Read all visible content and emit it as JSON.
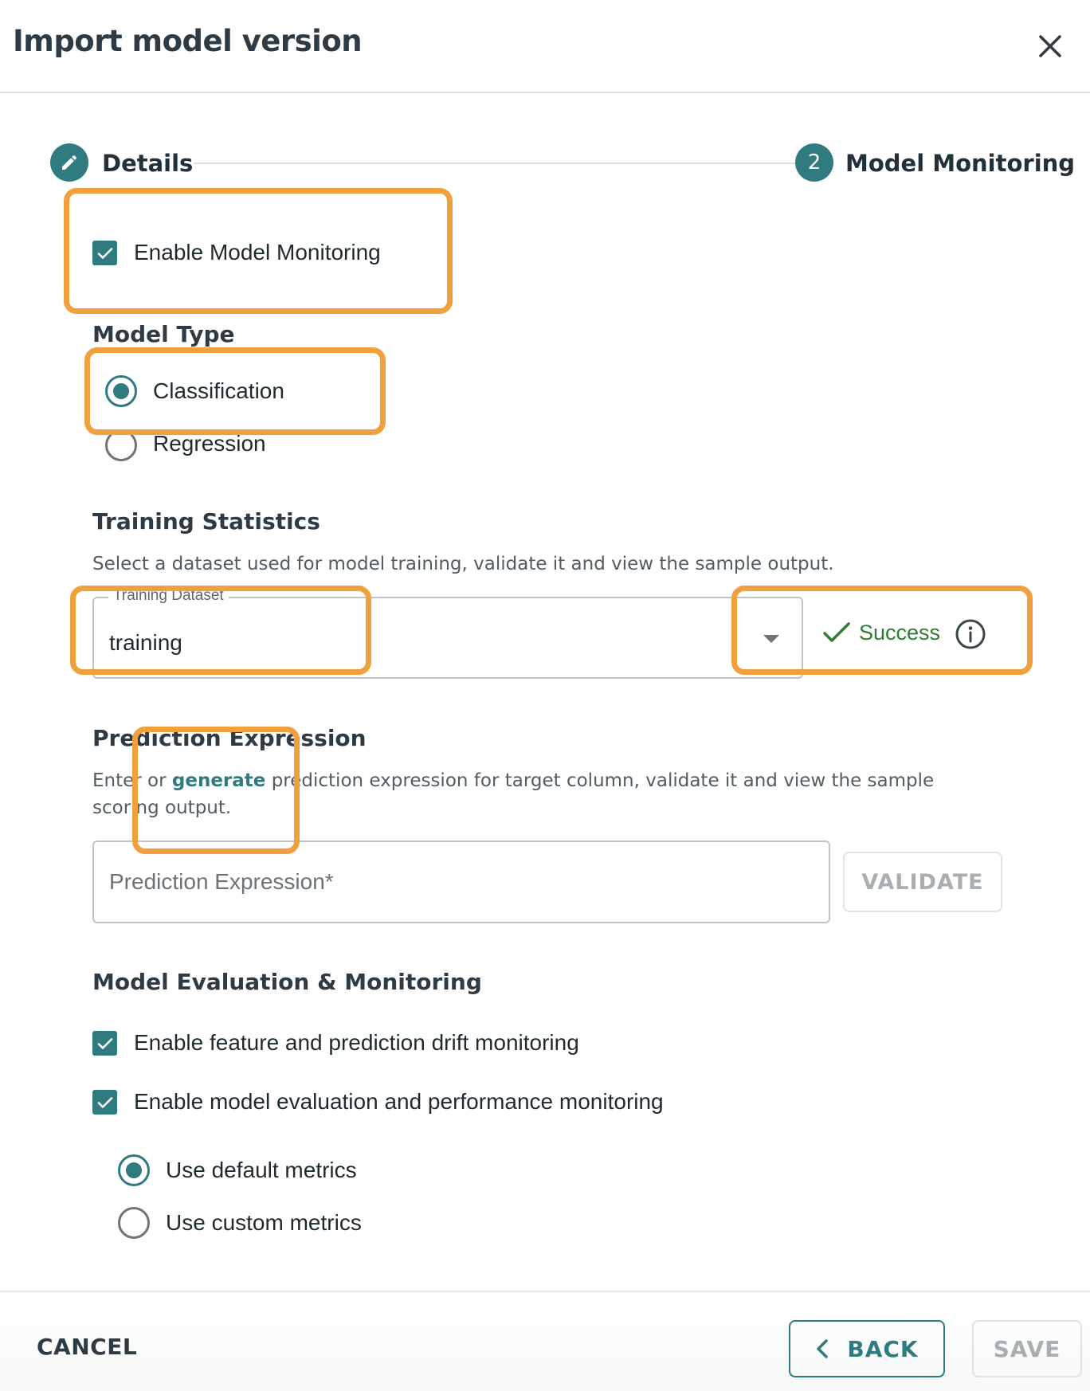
{
  "dialog": {
    "title": "Import model version"
  },
  "stepper": {
    "steps": [
      {
        "label": "Details",
        "icon": "pencil-icon"
      },
      {
        "number": "2",
        "label": "Model Monitoring"
      }
    ]
  },
  "enable_monitoring": {
    "label": "Enable Model Monitoring",
    "checked": true
  },
  "model_type": {
    "title": "Model Type",
    "options": [
      {
        "label": "Classification",
        "selected": true
      },
      {
        "label": "Regression",
        "selected": false
      }
    ]
  },
  "training_statistics": {
    "title": "Training Statistics",
    "description": "Select a dataset used for model training, validate it and view the sample output.",
    "dataset_field_label": "Training Dataset",
    "dataset_value": "training",
    "status": "Success"
  },
  "prediction_expression": {
    "title": "Prediction Expression",
    "description_prefix": "Enter or ",
    "description_link": "generate",
    "description_suffix": " prediction expression for target column, validate it and view the sample scoring output.",
    "placeholder": "Prediction Expression*",
    "value": "",
    "validate_label": "VALIDATE"
  },
  "evaluation": {
    "title": "Model Evaluation & Monitoring",
    "checkboxes": [
      {
        "label": "Enable feature and prediction drift monitoring",
        "checked": true
      },
      {
        "label": "Enable model evaluation and performance monitoring",
        "checked": true
      }
    ],
    "metrics_options": [
      {
        "label": "Use default metrics",
        "selected": true
      },
      {
        "label": "Use custom metrics",
        "selected": false
      }
    ]
  },
  "footer": {
    "cancel_label": "CANCEL",
    "back_label": "BACK",
    "save_label": "SAVE"
  },
  "colors": {
    "accent": "#2f7b80",
    "success": "#2e7d32",
    "highlight": "#f0a03c"
  }
}
